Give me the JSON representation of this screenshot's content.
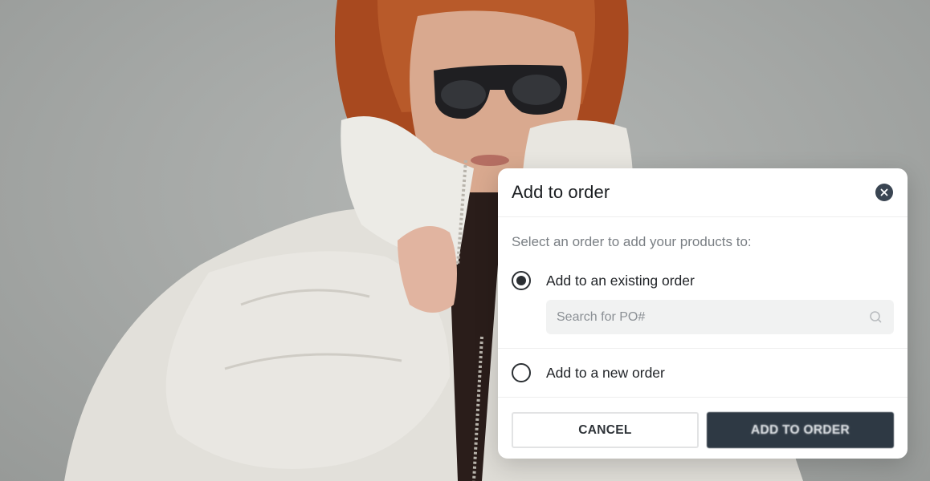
{
  "dialog": {
    "title": "Add to order",
    "instruction": "Select an order to add your products to:",
    "options": {
      "existing": {
        "label": "Add to an existing order",
        "selected": true
      },
      "new": {
        "label": "Add to a new order",
        "selected": false
      }
    },
    "search": {
      "placeholder": "Search for PO#",
      "value": "",
      "icon": "search-icon"
    },
    "buttons": {
      "cancel": "CANCEL",
      "add": "ADD TO ORDER"
    },
    "close_icon": "close-icon"
  },
  "colors": {
    "primary_button": "#2e3944",
    "close_button": "#3a4552",
    "background": "#a7aaa8"
  }
}
